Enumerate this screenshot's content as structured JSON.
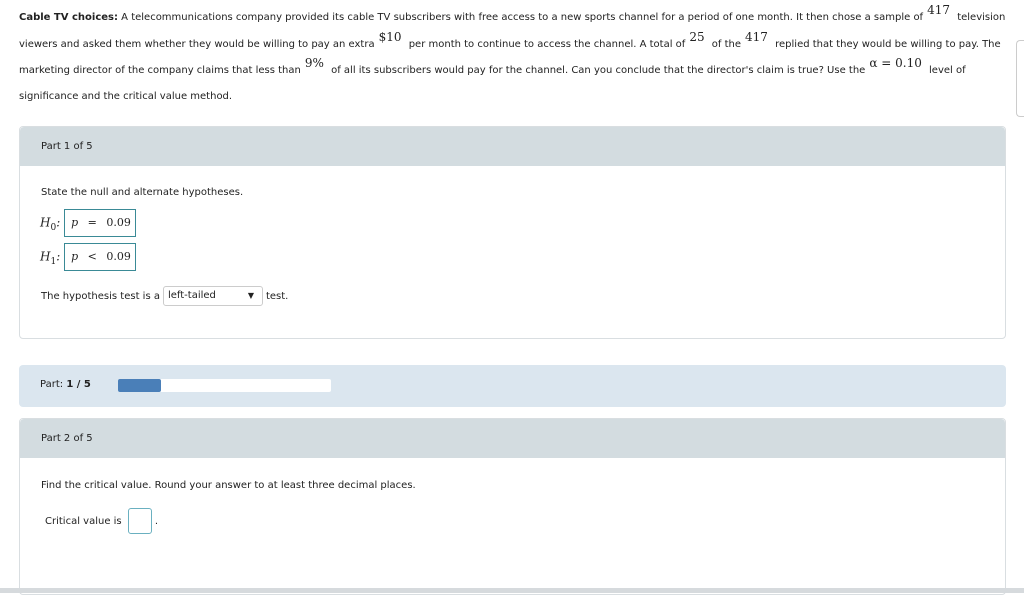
{
  "question": {
    "title": "Cable TV choices:",
    "t1": "A telecommunications company provided its cable TV subscribers with free access to a new sports channel for a period of one month. It then chose a sample of",
    "n": "417",
    "t2": "television viewers and asked them whether they would be willing to pay an extra",
    "price": "$10",
    "t3": "per month to continue to access the channel. A total of",
    "x": "25",
    "t4": "of the",
    "n2": "417",
    "t5": "replied that they would be willing to pay. The marketing director of the company claims that less than",
    "pct": "9%",
    "t6": "of all its subscribers would pay for the channel. Can you conclude that the director's claim is true? Use the",
    "alpha": "α = 0.10",
    "t7": "level of significance and the critical value method."
  },
  "part1": {
    "header": "Part 1 of 5",
    "instruction": "State the null and alternate hypotheses.",
    "h0_label": "H",
    "h0_sub": "0",
    "h0_sym": "p",
    "h0_op": "=",
    "h0_val": "0.09",
    "h1_label": "H",
    "h1_sub": "1",
    "h1_sym": "p",
    "h1_op": "<",
    "h1_val": "0.09",
    "test_pre": "The hypothesis test is a",
    "test_value": "left-tailed",
    "test_post": "test."
  },
  "progress": {
    "label": "Part:",
    "value": "1 / 5",
    "fraction": 0.2,
    "color": "#4a7fb8"
  },
  "part2": {
    "header": "Part 2 of 5",
    "instruction": "Find the critical value. Round your answer to at least three decimal places.",
    "answer_label": "Critical value is",
    "answer_suffix": "."
  }
}
